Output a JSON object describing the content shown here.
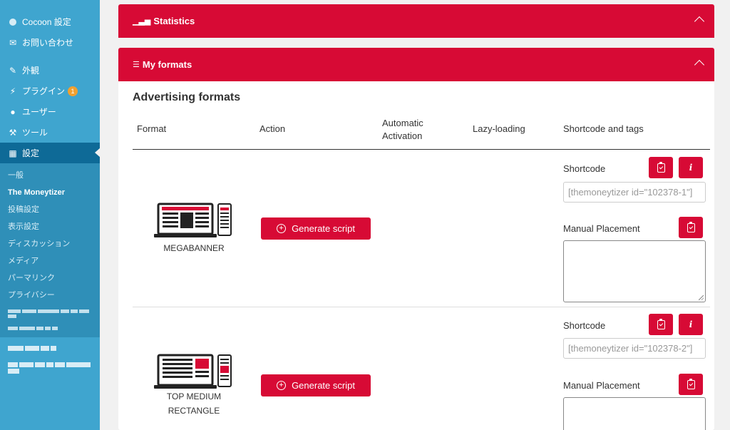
{
  "sidebar": {
    "items": [
      {
        "label": "Cocoon 設定",
        "icon": "cocoon-circle-icon"
      },
      {
        "label": "お問い合わせ",
        "icon": "mail-icon"
      },
      {
        "label": "外観",
        "icon": "appearance-brush-icon"
      },
      {
        "label": "プラグイン",
        "icon": "plugin-icon",
        "badge": "1"
      },
      {
        "label": "ユーザー",
        "icon": "user-icon"
      },
      {
        "label": "ツール",
        "icon": "wrench-icon"
      },
      {
        "label": "設定",
        "icon": "settings-icon",
        "active": true
      }
    ],
    "submenu": [
      "一般",
      "The Moneytizer",
      "投稿設定",
      "表示設定",
      "ディスカッション",
      "メディア",
      "パーマリンク",
      "プライバシー"
    ],
    "current_sub": "The Moneytizer"
  },
  "statistics": {
    "title": "Statistics",
    "icon": "bar-chart-icon"
  },
  "formats": {
    "title": "My formats",
    "icon": "list-icon",
    "section_title": "Advertising formats",
    "columns": {
      "format": "Format",
      "action": "Action",
      "automatic_1": "Automatic",
      "automatic_2": "Activation",
      "lazy": "Lazy-loading",
      "shortcode": "Shortcode and tags"
    },
    "rows": [
      {
        "name": "MEGABANNER",
        "name2": "",
        "button": "Generate script",
        "shortcode_label": "Shortcode",
        "shortcode_value": "[themoneytizer id=\"102378-1\"]",
        "manual_label": "Manual Placement"
      },
      {
        "name": "TOP MEDIUM",
        "name2": "RECTANGLE",
        "button": "Generate script",
        "shortcode_label": "Shortcode",
        "shortcode_value": "[themoneytizer id=\"102378-2\"]",
        "manual_label": "Manual Placement"
      }
    ]
  },
  "colors": {
    "accent": "#d70a35",
    "sidebar": "#3fa5cf",
    "sidebar_active": "#0e6a97"
  }
}
